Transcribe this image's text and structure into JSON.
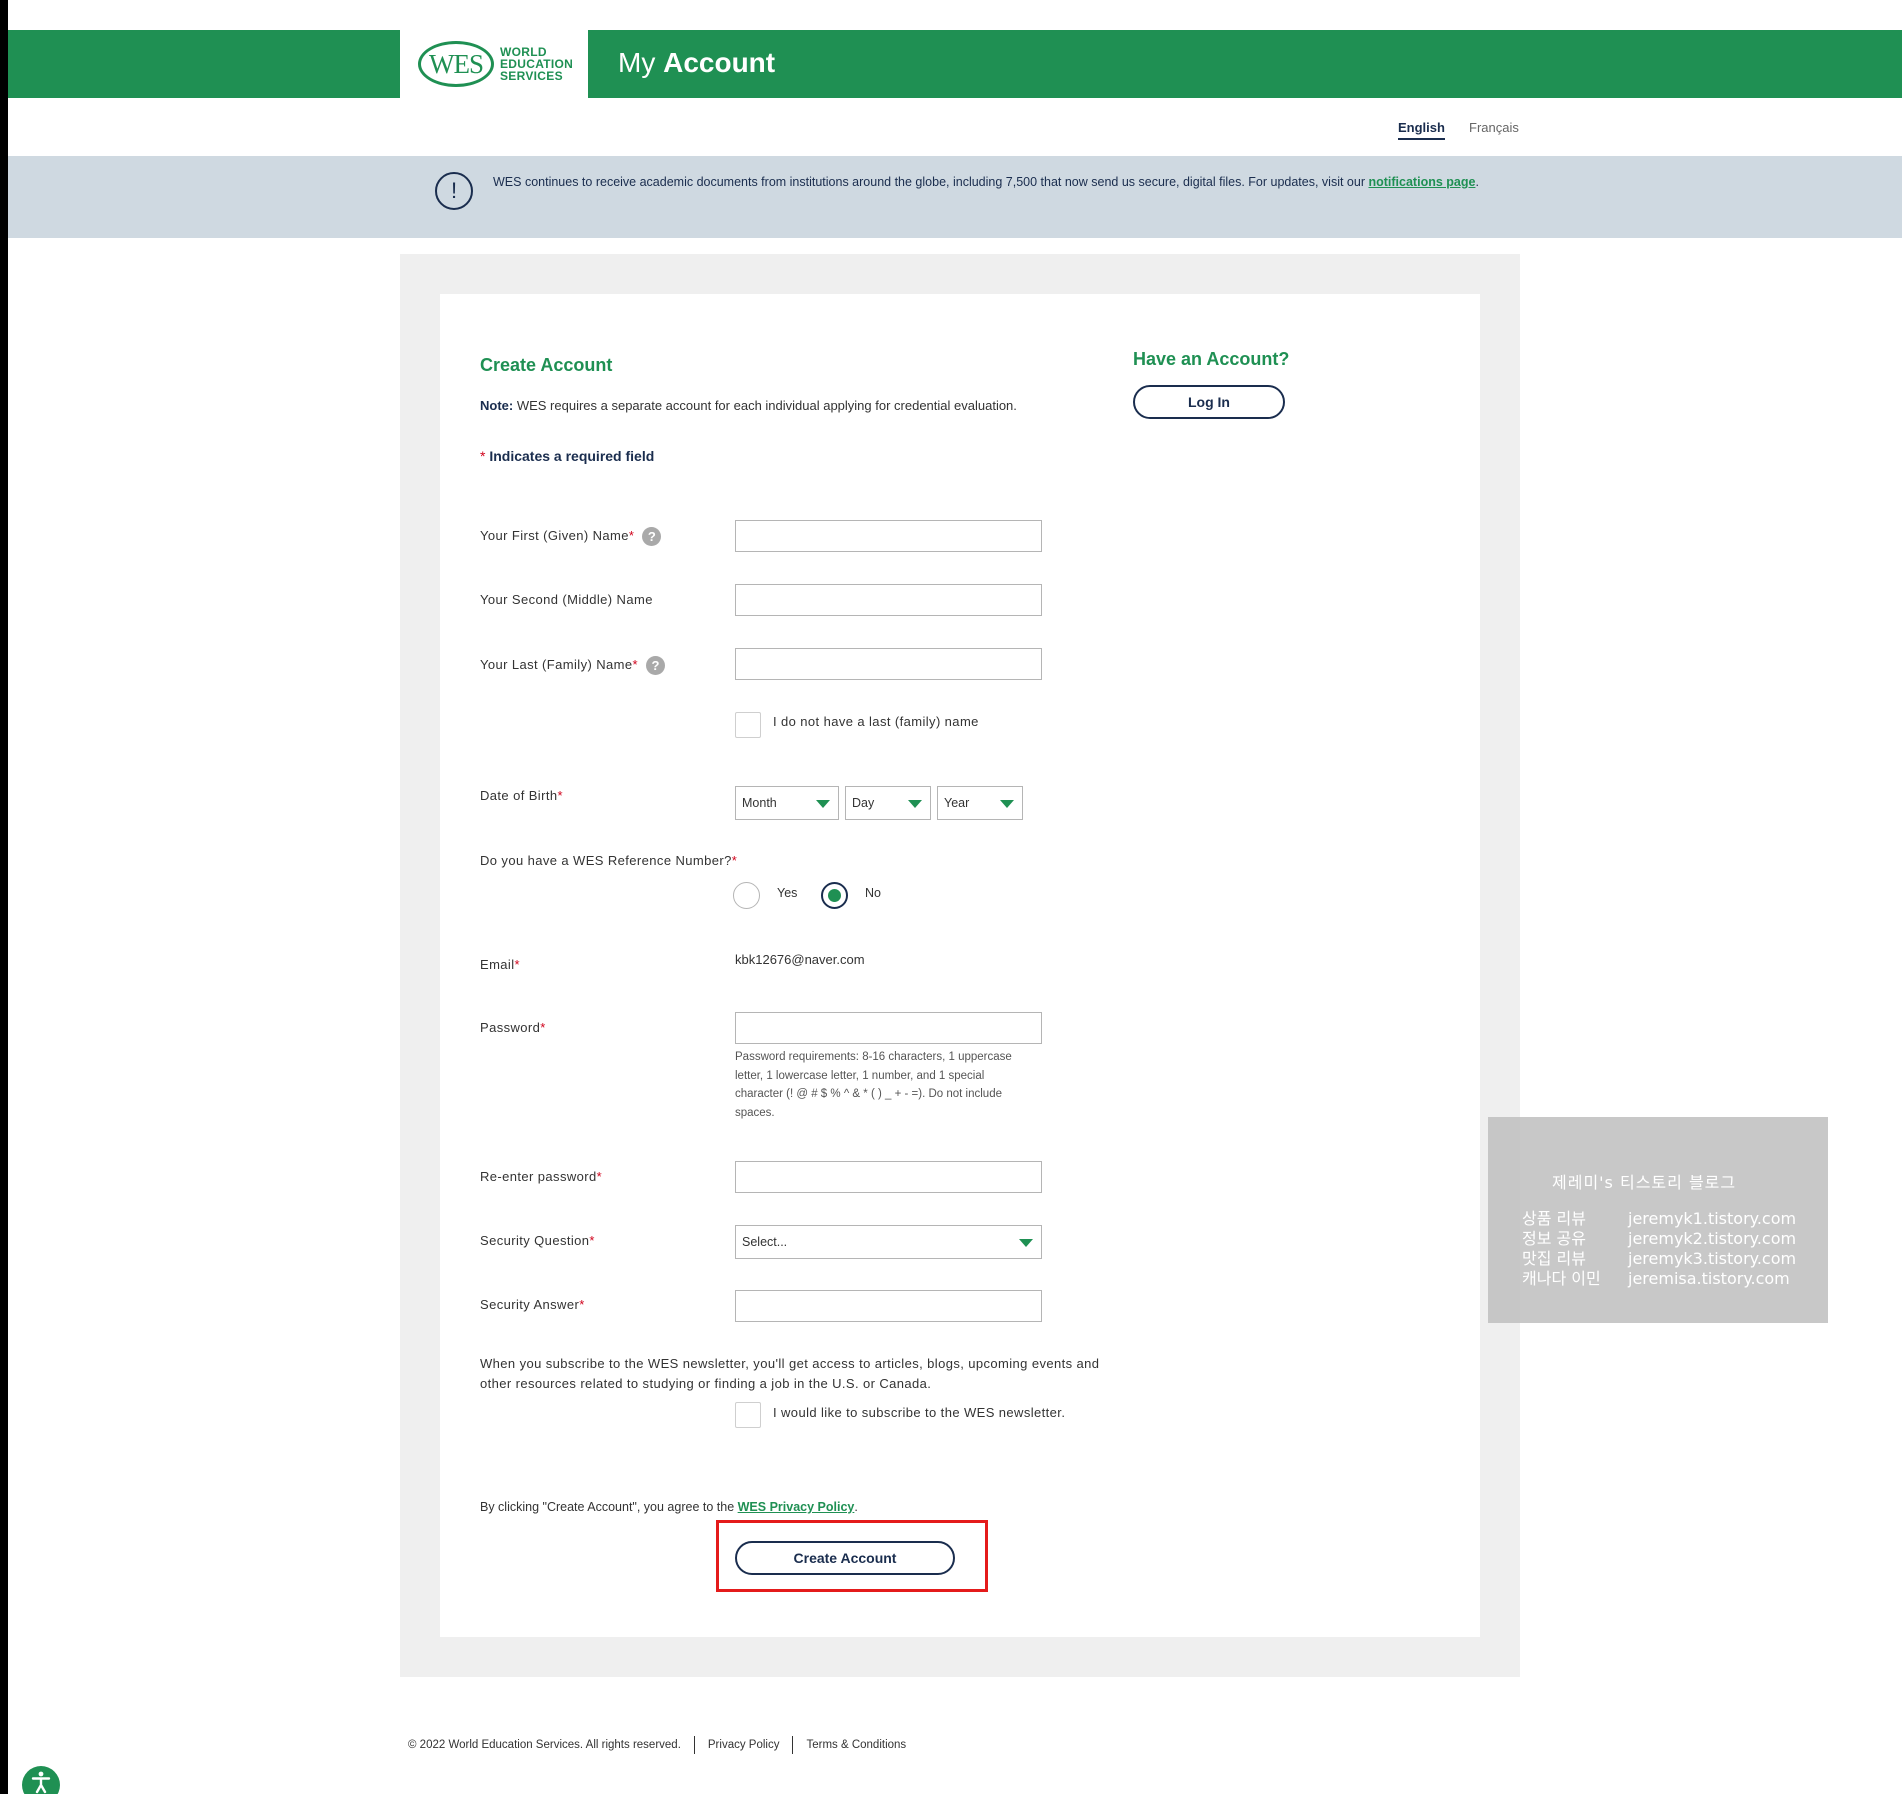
{
  "header": {
    "logo_mark": "WES",
    "logo_lines": [
      "WORLD",
      "EDUCATION",
      "SERVICES"
    ],
    "title_prefix": "My",
    "title_bold": "Account"
  },
  "language": {
    "english": "English",
    "french": "Français"
  },
  "notice": {
    "text": "WES continues to receive academic documents from institutions around the globe, including 7,500 that now send us secure, digital files. For updates, visit our ",
    "link": "notifications page",
    "suffix": "."
  },
  "form": {
    "title": "Create Account",
    "note_label": "Note:",
    "note_text": " WES requires a separate account for each individual applying for credential evaluation.",
    "required_star": "*",
    "required_text": " Indicates a required field",
    "first_name_label": "Your First (Given) Name",
    "middle_name_label": "Your Second (Middle) Name",
    "last_name_label": "Your Last (Family) Name",
    "no_last_name_label": "I do not have a last (family) name",
    "dob_label": "Date of Birth",
    "dob_month": "Month",
    "dob_day": "Day",
    "dob_year": "Year",
    "ref_question": "Do you have a WES Reference Number?",
    "ref_yes": "Yes",
    "ref_no": "No",
    "ref_selected": "No",
    "email_label": "Email",
    "email_value": "kbk12676@naver.com",
    "password_label": "Password",
    "password_requirements": "Password requirements: 8-16 characters, 1 uppercase letter, 1 lowercase letter, 1 number, and 1 special character (! @ # $ % ^ & * ( ) _ + - =). Do not include spaces.",
    "reenter_label": "Re-enter password",
    "security_question_label": "Security Question",
    "security_question_value": "Select...",
    "security_answer_label": "Security Answer",
    "newsletter_text": "When you subscribe to the WES newsletter, you'll get access to articles, blogs, upcoming events and other resources related to studying or finding a job in the U.S. or Canada.",
    "newsletter_checkbox_label": "I would like to subscribe to the WES newsletter.",
    "agree_text": "By clicking \"Create Account\", you agree to the ",
    "agree_link": "WES Privacy Policy",
    "agree_suffix": ".",
    "create_button": "Create Account",
    "help_glyph": "?"
  },
  "login": {
    "title": "Have an Account?",
    "button": "Log In"
  },
  "watermark": {
    "title": "제레미's 티스토리 블로그",
    "rows": [
      {
        "k": "상품 리뷰",
        "v": "jeremyk1.tistory.com"
      },
      {
        "k": "정보 공유",
        "v": "jeremyk2.tistory.com"
      },
      {
        "k": "맛집 리뷰",
        "v": "jeremyk3.tistory.com"
      },
      {
        "k": "캐나다 이민",
        "v": "jeremisa.tistory.com"
      }
    ]
  },
  "footer": {
    "copyright": "© 2022 World Education Services. All rights reserved.",
    "privacy": "Privacy Policy",
    "terms": "Terms & Conditions"
  },
  "colors": {
    "brand_green": "#1f9053",
    "navy": "#1a2d4e",
    "notice_bg": "#cfd9e1",
    "highlight_red": "#e41b1b"
  },
  "icons": {
    "notice": "exclamation-circle-icon",
    "help": "question-circle-icon",
    "dropdown": "caret-down-icon",
    "accessibility": "accessibility-icon"
  }
}
